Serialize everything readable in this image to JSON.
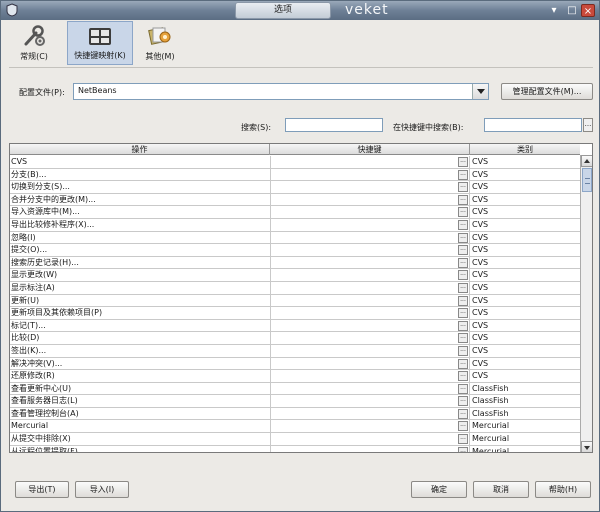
{
  "window": {
    "title": "选项",
    "brand": "veket",
    "controls": {
      "menu": "▾",
      "maximize": "□",
      "close": "×"
    }
  },
  "categories": [
    {
      "label": "常规(C)",
      "icon": "wrench-icon",
      "selected": false
    },
    {
      "label": "快捷键映射(K)",
      "icon": "keyboard-icon",
      "selected": true
    },
    {
      "label": "其他(M)",
      "icon": "misc-icon",
      "selected": false
    }
  ],
  "profile": {
    "label": "配置文件(P):",
    "value": "NetBeans",
    "manage_label": "管理配置文件(M)..."
  },
  "search": {
    "label": "搜索(S):",
    "value": "",
    "key_label": "在快捷键中搜索(B):",
    "key_value": "",
    "more_label": "..."
  },
  "table": {
    "columns": {
      "action": "操作",
      "shortcut": "快捷键",
      "category": "类别"
    },
    "shortcut_button": "...",
    "rows": [
      {
        "action": "CVS",
        "shortcut": "",
        "category": "CVS"
      },
      {
        "action": "分支(B)...",
        "shortcut": "",
        "category": "CVS"
      },
      {
        "action": "切换到分支(S)...",
        "shortcut": "",
        "category": "CVS"
      },
      {
        "action": "合并分支中的更改(M)...",
        "shortcut": "",
        "category": "CVS"
      },
      {
        "action": "导入资源库中(M)...",
        "shortcut": "",
        "category": "CVS"
      },
      {
        "action": "导出比较修补程序(X)...",
        "shortcut": "",
        "category": "CVS"
      },
      {
        "action": "忽略(I)",
        "shortcut": "",
        "category": "CVS"
      },
      {
        "action": "提交(O)...",
        "shortcut": "",
        "category": "CVS"
      },
      {
        "action": "搜索历史记录(H)...",
        "shortcut": "",
        "category": "CVS"
      },
      {
        "action": "显示更改(W)",
        "shortcut": "",
        "category": "CVS"
      },
      {
        "action": "显示标注(A)",
        "shortcut": "",
        "category": "CVS"
      },
      {
        "action": "更新(U)",
        "shortcut": "",
        "category": "CVS"
      },
      {
        "action": "更新项目及其依赖项目(P)",
        "shortcut": "",
        "category": "CVS"
      },
      {
        "action": "标记(T)...",
        "shortcut": "",
        "category": "CVS"
      },
      {
        "action": "比较(D)",
        "shortcut": "",
        "category": "CVS"
      },
      {
        "action": "签出(K)...",
        "shortcut": "",
        "category": "CVS"
      },
      {
        "action": "解决冲突(V)...",
        "shortcut": "",
        "category": "CVS"
      },
      {
        "action": "还原修改(R)",
        "shortcut": "",
        "category": "CVS"
      },
      {
        "action": "查看更新中心(U)",
        "shortcut": "",
        "category": "ClassFish"
      },
      {
        "action": "查看服务器日志(L)",
        "shortcut": "",
        "category": "ClassFish"
      },
      {
        "action": "查看管理控制台(A)",
        "shortcut": "",
        "category": "ClassFish"
      },
      {
        "action": "Mercurial",
        "shortcut": "",
        "category": "Mercurial"
      },
      {
        "action": "从提交中排除(X)",
        "shortcut": "",
        "category": "Mercurial"
      },
      {
        "action": "从远程位置提取(F)",
        "shortcut": "",
        "category": "Mercurial"
      }
    ]
  },
  "buttons": {
    "export": "导出(T)",
    "import": "导入(I)",
    "ok": "确定",
    "cancel": "取消",
    "help": "帮助(H)"
  }
}
